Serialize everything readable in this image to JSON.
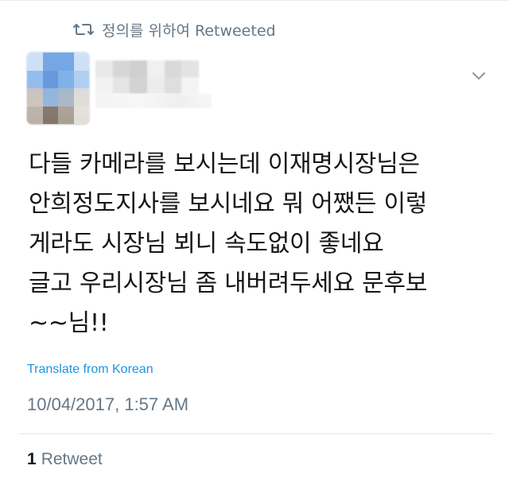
{
  "retweet_context": {
    "icon": "retweet-icon",
    "text": "정의를 위하여 Retweeted"
  },
  "tweet": {
    "author_avatar": "avatar (blurred)",
    "menu_icon": "chevron-down-icon",
    "text_lines": [
      "다들 카메라를 보시는데 이재명시장님은",
      "안희정도지사를 보시네요  뭐 어쨌든 이렇",
      "게라도 시장님 뵈니 속도없이 좋네요",
      "글고 우리시장님 좀 내버려두세요 문후보",
      "~~님!!"
    ],
    "translate_label": "Translate from Korean",
    "timestamp": "10/04/2017, 1:57 AM",
    "retweet_count": "1",
    "retweet_label": "Retweet"
  },
  "colors": {
    "text": "#14171a",
    "muted": "#657786",
    "link": "#1b95e0",
    "divider": "#e1e8ed"
  }
}
